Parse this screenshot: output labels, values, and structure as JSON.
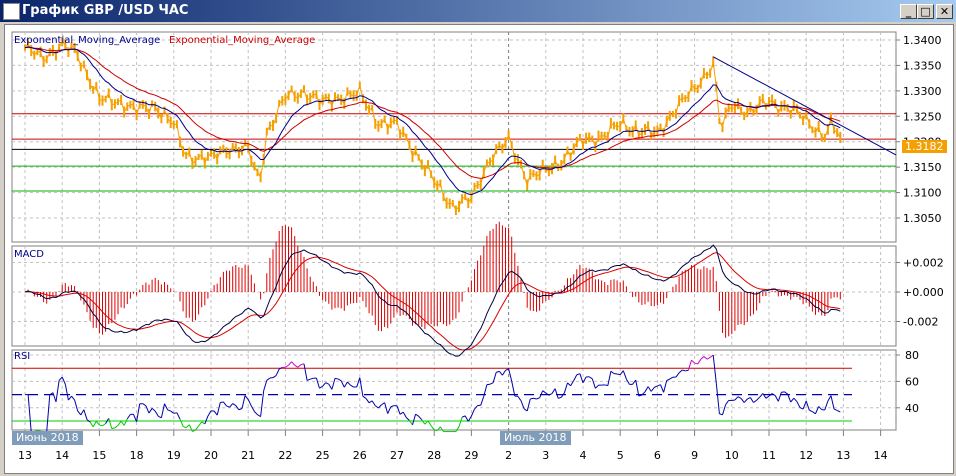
{
  "window": {
    "title": "График GBP /USD  ЧАС",
    "minimize": "_",
    "maximize": "□",
    "close": "✕"
  },
  "colors": {
    "price": "#f5a000",
    "ema_fast": "#00008b",
    "ema_slow": "#cc0000",
    "grid": "#c0c0c0",
    "rsi": "#0000aa",
    "rsi_high": "#cc00cc",
    "rsi_low": "#00cc00"
  },
  "legend": {
    "ema1": "Exponential_Moving_Average",
    "ema2": "Exponential_Moving_Average"
  },
  "current_price": "1.3182",
  "price_axis": [
    "1.3400",
    "1.3350",
    "1.3300",
    "1.3250",
    "1.3200",
    "1.3150",
    "1.3100",
    "1.3050"
  ],
  "macd": {
    "title": "MACD",
    "axis": [
      "+0.002",
      "+0.000",
      "-0.002"
    ]
  },
  "rsi": {
    "title": "RSI",
    "axis": [
      "80",
      "60",
      "40"
    ],
    "levels": [
      70,
      50,
      30
    ]
  },
  "months": [
    "Июнь 2018",
    "Июль 2018"
  ],
  "days": [
    "13",
    "14",
    "15",
    "18",
    "19",
    "20",
    "21",
    "22",
    "25",
    "26",
    "27",
    "28",
    "29",
    "2",
    "3",
    "4",
    "5",
    "6",
    "9",
    "10",
    "11",
    "12",
    "13",
    "14"
  ],
  "chart_data": {
    "type": "line",
    "symbol": "GBP/USD",
    "timeframe": "H1",
    "ylim": [
      1.303,
      1.342
    ],
    "price_anchors": [
      [
        0,
        1.338
      ],
      [
        0.5,
        1.337
      ],
      [
        1,
        1.3385
      ],
      [
        1.4,
        1.3378
      ],
      [
        2,
        1.328
      ],
      [
        2.5,
        1.3282
      ],
      [
        3,
        1.326
      ],
      [
        3.5,
        1.3272
      ],
      [
        4,
        1.3232
      ],
      [
        4.3,
        1.3175
      ],
      [
        5,
        1.3165
      ],
      [
        5.5,
        1.319
      ],
      [
        6,
        1.3182
      ],
      [
        6.3,
        1.312
      ],
      [
        6.5,
        1.322
      ],
      [
        7,
        1.3285
      ],
      [
        7.5,
        1.33
      ],
      [
        8,
        1.3275
      ],
      [
        8.5,
        1.329
      ],
      [
        9,
        1.3292
      ],
      [
        9.5,
        1.324
      ],
      [
        10,
        1.323
      ],
      [
        10.5,
        1.318
      ],
      [
        11,
        1.312
      ],
      [
        11.5,
        1.3075
      ],
      [
        12,
        1.3085
      ],
      [
        12.5,
        1.317
      ],
      [
        13,
        1.32
      ],
      [
        13.5,
        1.313
      ],
      [
        14,
        1.314
      ],
      [
        14.5,
        1.317
      ],
      [
        15,
        1.32
      ],
      [
        15.5,
        1.3212
      ],
      [
        16,
        1.3232
      ],
      [
        16.5,
        1.3225
      ],
      [
        17,
        1.3212
      ],
      [
        17.5,
        1.327
      ],
      [
        18,
        1.33
      ],
      [
        18.5,
        1.3358
      ],
      [
        18.7,
        1.3222
      ],
      [
        19,
        1.327
      ],
      [
        19.5,
        1.3262
      ],
      [
        20,
        1.3276
      ],
      [
        20.5,
        1.327
      ],
      [
        21,
        1.324
      ],
      [
        21.5,
        1.3215
      ],
      [
        21.7,
        1.3236
      ],
      [
        22,
        1.3186
      ],
      [
        22.2,
        1.3182
      ]
    ],
    "horizontal_levels": {
      "red": [
        1.3255,
        1.3205
      ],
      "black": [
        1.3185
      ],
      "green": [
        1.3152,
        1.3103
      ]
    },
    "trendline": [
      [
        18.5,
        1.3367
      ],
      [
        24,
        1.3174
      ]
    ],
    "ema_periods": [
      12,
      26
    ],
    "macd_params": [
      12,
      26,
      9
    ],
    "rsi_period": 14
  }
}
